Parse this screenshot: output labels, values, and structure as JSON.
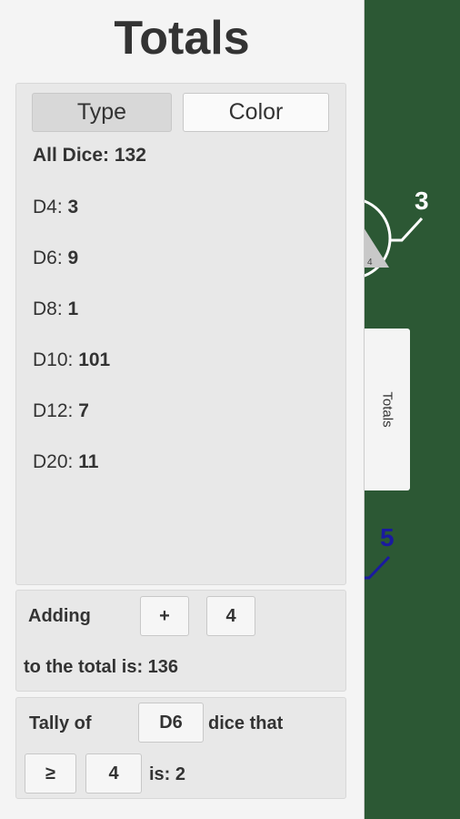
{
  "title": "Totals",
  "tabs": {
    "type": "Type",
    "color": "Color",
    "active": "Type"
  },
  "totals": [
    {
      "label": "All Dice:",
      "value": "132"
    },
    {
      "label": "D4:",
      "value": "3"
    },
    {
      "label": "D6:",
      "value": "9"
    },
    {
      "label": "D8:",
      "value": "1"
    },
    {
      "label": "D10:",
      "value": "101"
    },
    {
      "label": "D12:",
      "value": "7"
    },
    {
      "label": "D20:",
      "value": "11"
    }
  ],
  "adding": {
    "label": "Adding",
    "operator": "+",
    "amount": "4",
    "result": "to the total is: 136"
  },
  "tally": {
    "label": "Tally of",
    "die": "D6",
    "suffix": "dice that",
    "comparator": "≥",
    "threshold": "4",
    "result": "is: 2"
  },
  "side_tab": "Totals",
  "board": {
    "die_label_1": "3",
    "die_label_2": "5",
    "die_face": "4",
    "felt_color": "#2c5834",
    "label_blue": "#1a1aa0"
  }
}
